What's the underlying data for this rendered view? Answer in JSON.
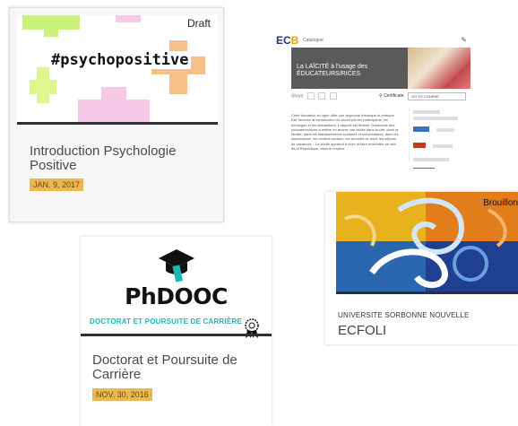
{
  "cards": [
    {
      "badge": "Draft",
      "thumbnail_text": "#psychopositive",
      "title": "Introduction Psychologie Positive",
      "date": "JAN. 9, 2017"
    },
    {
      "logo": "EC",
      "logo_accent": "B",
      "category": "Catalogue",
      "hero_title": "La LAÏCITÉ à l'usage des ÉDUCATEURS/RICES",
      "share_label": "Share",
      "certificate_label": "Certificate",
      "enroll_label": "GO TO COURSE",
      "description": "Cette formation en ligne offre une approche théorique et pratique. Elle favorise la construction du savoir par les participants, les échanges et les interactions. L'objectif est fédérer l'ensemble des éducateurs/rices à mettre en œuvre une laïcité dans la cité, dans la famille, dans les établissements scolaires et universitaires, dans les associations, les centres sociaux, les accueils de loisir, les séjours de vacances... La laïcité apprend à vivre et faire ensemble au sein de la République, dans le respect"
    },
    {
      "badge": "Brouillon",
      "organization": "UNIVERSITE SORBONNE NOUVELLE",
      "title": "ECFOLI"
    },
    {
      "brand": "PhDOOC",
      "subtitle": "DOCTORAT ET POURSUITE DE CARRIÈRE",
      "title": "Doctorat et Poursuite de Carrière",
      "date": "NOV. 30, 2016"
    }
  ],
  "colors": {
    "date_badge": "#e9b94f",
    "divider": "#2c2f36",
    "phdooc_teal": "#1db6b6",
    "ecb_blue": "#1d3b70",
    "ecb_accent": "#e7a400"
  },
  "icons": [
    "graduation-cap-icon",
    "award-ribbon-icon",
    "edit-icon",
    "certificate-icon"
  ]
}
